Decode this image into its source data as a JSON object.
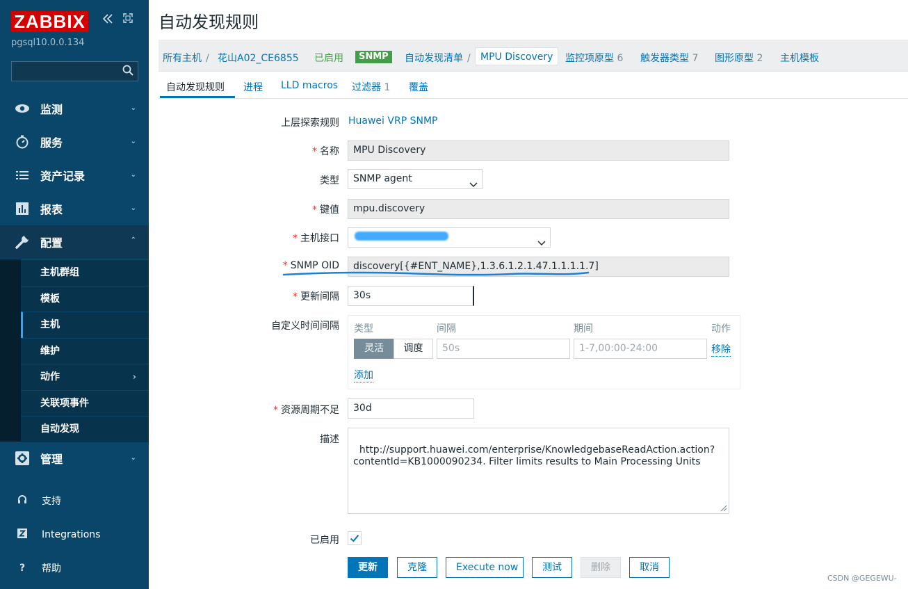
{
  "sidebar": {
    "logo": "ZABBIX",
    "collapse_icon": "double-chevron-left-icon",
    "kiosk_icon": "expand-icon",
    "server_name": "pgsql10.0.0.134",
    "search_placeholder": "",
    "menu": [
      {
        "label": "监测",
        "icon": "eye-icon",
        "expanded": false
      },
      {
        "label": "服务",
        "icon": "clock-icon",
        "expanded": false
      },
      {
        "label": "资产记录",
        "icon": "list-icon",
        "expanded": false
      },
      {
        "label": "报表",
        "icon": "bar-chart-icon",
        "expanded": false
      },
      {
        "label": "配置",
        "icon": "wrench-icon",
        "expanded": true
      }
    ],
    "submenu": [
      {
        "label": "主机群组"
      },
      {
        "label": "模板"
      },
      {
        "label": "主机"
      },
      {
        "label": "维护"
      },
      {
        "label": "动作"
      },
      {
        "label": "关联项事件"
      },
      {
        "label": "自动发现"
      }
    ],
    "admin": {
      "label": "管理",
      "icon": "gear-icon"
    },
    "bottom": [
      {
        "label": "支持",
        "icon": "headset-icon"
      },
      {
        "label": "Integrations",
        "icon": "z-icon"
      },
      {
        "label": "帮助",
        "icon": "question-icon"
      }
    ]
  },
  "header": {
    "title": "自动发现规则",
    "breadcrumbs": {
      "all_hosts": "所有主机",
      "sep": "/",
      "host": "花山A02_CE6855",
      "enabled": "已启用",
      "snmp": "SNMP",
      "discovery_list": "自动发现清单",
      "current": "MPU Discovery",
      "item_proto": "监控项原型",
      "item_proto_count": "6",
      "trigger_proto": "触发器类型",
      "trigger_proto_count": "7",
      "graph_proto": "图形原型",
      "graph_proto_count": "2",
      "host_templates": "主机模板"
    },
    "tabs": [
      {
        "label": "自动发现规则",
        "count": ""
      },
      {
        "label": "进程",
        "count": ""
      },
      {
        "label": "LLD macros",
        "count": ""
      },
      {
        "label": "过滤器",
        "count": "1"
      },
      {
        "label": "覆盖",
        "count": ""
      }
    ]
  },
  "form": {
    "parent_rule": {
      "label": "上层探索规则",
      "value": "Huawei VRP SNMP"
    },
    "name": {
      "label": "名称",
      "value": "MPU Discovery"
    },
    "type": {
      "label": "类型",
      "value": "SNMP agent"
    },
    "key": {
      "label": "键值",
      "value": "mpu.discovery"
    },
    "interface": {
      "label": "主机接口",
      "value": ""
    },
    "snmp_oid": {
      "label": "SNMP OID",
      "value": "discovery[{#ENT_NAME},1.3.6.1.2.1.47.1.1.1.1.7]"
    },
    "update_interval": {
      "label": "更新间隔",
      "value": "30s"
    },
    "custom_intervals": {
      "label": "自定义时间间隔",
      "headers": {
        "type": "类型",
        "interval": "间隔",
        "period": "期间",
        "action": "动作"
      },
      "mode_flexible": "灵活",
      "mode_scheduling": "调度",
      "interval_placeholder": "50s",
      "period_placeholder": "1-7,00:00-24:00",
      "remove": "移除",
      "add": "添加"
    },
    "lost_resources": {
      "label": "资源周期不足",
      "value": "30d"
    },
    "description": {
      "label": "描述",
      "value": "http://support.huawei.com/enterprise/KnowledgebaseReadAction.action?\ncontentId=KB1000090234. Filter limits results to Main Processing Units"
    },
    "enabled": {
      "label": "已启用",
      "checked": true
    }
  },
  "buttons": {
    "update": "更新",
    "clone": "克隆",
    "execute_now": "Execute now",
    "test": "测试",
    "delete": "删除",
    "cancel": "取消"
  },
  "watermark": "CSDN @GEGEWU-",
  "colors": {
    "sidebar_bg": "#0a466a",
    "logo_red": "#d40000",
    "link_blue": "#0275b8",
    "enabled_green": "#429e47",
    "required_red": "#e33734"
  }
}
